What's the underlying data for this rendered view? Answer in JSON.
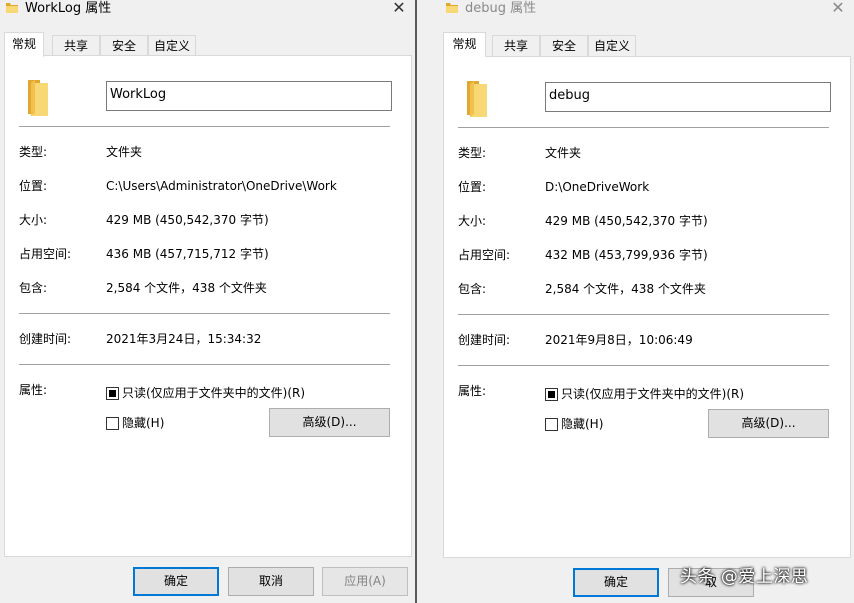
{
  "dialogs": [
    {
      "title": "WorkLog 属性",
      "tabs": [
        "常规",
        "共享",
        "安全",
        "自定义"
      ],
      "name_value": "WorkLog",
      "rows": [
        {
          "label": "类型:",
          "value": "文件夹"
        },
        {
          "label": "位置:",
          "value": "C:\\Users\\Administrator\\OneDrive\\Work"
        },
        {
          "label": "大小:",
          "value": "429 MB (450,542,370 字节)"
        },
        {
          "label": "占用空间:",
          "value": "436 MB (457,715,712 字节)"
        },
        {
          "label": "包含:",
          "value": "2,584 个文件，438 个文件夹"
        }
      ],
      "created_label": "创建时间:",
      "created_value": "2021年3月24日，15:34:32",
      "attributes_label": "属性:",
      "readonly_label": "只读(仅应用于文件夹中的文件)(R)",
      "readonly_state": "indeterminate",
      "hidden_label": "隐藏(H)",
      "hidden_checked": false,
      "advanced_label": "高级(D)...",
      "ok_label": "确定",
      "cancel_label": "取消",
      "apply_label": "应用(A)"
    },
    {
      "title": "debug 属性",
      "tabs": [
        "常规",
        "共享",
        "安全",
        "自定义"
      ],
      "name_value": "debug",
      "rows": [
        {
          "label": "类型:",
          "value": "文件夹"
        },
        {
          "label": "位置:",
          "value": "D:\\OneDriveWork"
        },
        {
          "label": "大小:",
          "value": "429 MB (450,542,370 字节)"
        },
        {
          "label": "占用空间:",
          "value": "432 MB (453,799,936 字节)"
        },
        {
          "label": "包含:",
          "value": "2,584 个文件，438 个文件夹"
        }
      ],
      "created_label": "创建时间:",
      "created_value": "2021年9月8日，10:06:49",
      "attributes_label": "属性:",
      "readonly_label": "只读(仅应用于文件夹中的文件)(R)",
      "readonly_state": "indeterminate",
      "hidden_label": "隐藏(H)",
      "hidden_checked": false,
      "advanced_label": "高级(D)...",
      "ok_label": "确定",
      "cancel_label": "取"
    }
  ],
  "watermark": "头条 @爱上深思",
  "icons": {
    "title_icon": "folder-icon",
    "close_icon": "close-icon",
    "big_icon": "folder-icon"
  },
  "colors": {
    "folder_yellow": "#f8d775",
    "folder_dark": "#e0a82e",
    "default_button_border": "#0078d7"
  }
}
